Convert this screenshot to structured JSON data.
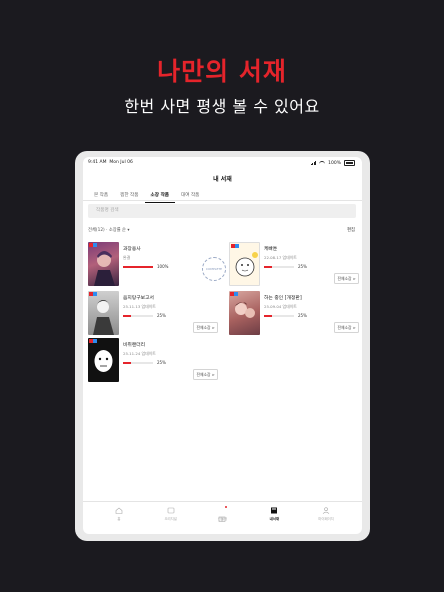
{
  "promo": {
    "title": "나만의 서재",
    "subtitle": "한번 사면 평생 볼 수 있어요"
  },
  "status": {
    "time": "9:41 AM",
    "date": "Mon Jul 06",
    "battery": "100%"
  },
  "header": {
    "title": "내 서재"
  },
  "tabs": [
    {
      "label": "본 작품"
    },
    {
      "label": "찜한 작품"
    },
    {
      "label": "소장 작품",
      "active": true
    },
    {
      "label": "대여 작품"
    }
  ],
  "search": {
    "placeholder": "작품명 검색"
  },
  "filter": {
    "label": "전체(12) · 소장률 순 ▾"
  },
  "edit_label": "편집",
  "items": [
    {
      "title": "과장용사",
      "sub": "완결",
      "progress": 100,
      "progress_label": "100%",
      "buy_label": ""
    },
    {
      "title": "케빠툰",
      "sub": "22.08.17 업데이트",
      "progress": 25,
      "progress_label": "25%",
      "buy_label": "전체소장 >"
    },
    {
      "title": "음지탕구보고서",
      "sub": "25.11.13 업데이트",
      "progress": 25,
      "progress_label": "25%",
      "buy_label": "전체소장 >"
    },
    {
      "title": "하는 중인 [개정판]",
      "sub": "25.09.04 업데이트",
      "progress": 25,
      "progress_label": "25%",
      "buy_label": "전체소장 >"
    },
    {
      "title": "비취랜더리",
      "sub": "25.11.24 업데이트",
      "progress": 25,
      "progress_label": "25%",
      "buy_label": "전체소장 >"
    }
  ],
  "stamp_text": "COMPLETE",
  "bottom_nav": [
    {
      "label": "홈",
      "icon": "home-icon"
    },
    {
      "label": "오리지널",
      "icon": "original-icon"
    },
    {
      "label": "선물함",
      "icon": "gift-icon"
    },
    {
      "label": "내서재",
      "icon": "library-icon",
      "active": true
    },
    {
      "label": "마이페이지",
      "icon": "person-icon"
    }
  ],
  "colors": {
    "accent": "#e5242b",
    "background": "#1b1a1f"
  }
}
